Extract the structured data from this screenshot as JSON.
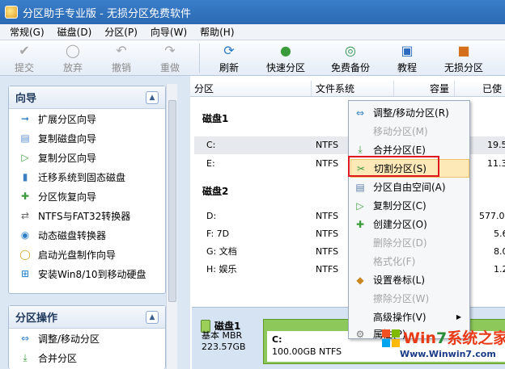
{
  "window": {
    "title": "分区助手专业版 - 无损分区免费软件"
  },
  "menubar": [
    "常规(G)",
    "磁盘(D)",
    "分区(P)",
    "向导(W)",
    "帮助(H)"
  ],
  "toolbar": {
    "submit": "提交",
    "discard": "放弃",
    "undo": "撤销",
    "redo": "重做",
    "refresh": "刷新",
    "quick_partition": "快速分区",
    "free_backup": "免费备份",
    "tutorial": "教程",
    "lossless": "无损分区"
  },
  "wizard_panel": {
    "title": "向导",
    "items": [
      "扩展分区向导",
      "复制磁盘向导",
      "复制分区向导",
      "迁移系统到固态磁盘",
      "分区恢复向导",
      "NTFS与FAT32转换器",
      "动态磁盘转换器",
      "启动光盘制作向导",
      "安装Win8/10到移动硬盘"
    ]
  },
  "ops_panel": {
    "title": "分区操作",
    "items": [
      "调整/移动分区",
      "合并分区"
    ]
  },
  "table": {
    "columns": [
      "分区",
      "文件系统",
      "容量",
      "已使"
    ],
    "disk1": "磁盘1",
    "disk2": "磁盘2",
    "disk1_rows": [
      {
        "name": "C:",
        "fs": "NTFS",
        "used": "19.5"
      },
      {
        "name": "E:",
        "fs": "NTFS",
        "used": "11.3"
      }
    ],
    "disk2_rows": [
      {
        "name": "D:",
        "fs": "NTFS",
        "used": "577.0"
      },
      {
        "name": "F: 7D",
        "fs": "NTFS",
        "used": "5.6"
      },
      {
        "name": "G: 文档",
        "fs": "NTFS",
        "used": "8.0"
      },
      {
        "name": "H: 娱乐",
        "fs": "NTFS",
        "used": "1.2"
      }
    ]
  },
  "diskmap": {
    "name": "磁盘1",
    "type": "基本 MBR",
    "size": "223.57GB",
    "partition_label": "C:",
    "partition_info": "100.00GB NTFS"
  },
  "context_menu": [
    {
      "label": "调整/移动分区(R)",
      "enabled": true
    },
    {
      "label": "移动分区(M)",
      "enabled": false
    },
    {
      "label": "合并分区(E)",
      "enabled": true
    },
    {
      "label": "切割分区(S)",
      "enabled": true,
      "highlighted": true
    },
    {
      "label": "分区自由空间(A)",
      "enabled": true
    },
    {
      "label": "复制分区(C)",
      "enabled": true
    },
    {
      "label": "创建分区(O)",
      "enabled": true
    },
    {
      "label": "删除分区(D)",
      "enabled": false
    },
    {
      "label": "格式化(F)",
      "enabled": false
    },
    {
      "label": "设置卷标(L)",
      "enabled": true
    },
    {
      "label": "擦除分区(W)",
      "enabled": false
    },
    {
      "label": "高级操作(V)",
      "enabled": true,
      "submenu": true
    },
    {
      "label": "属性(P)",
      "enabled": true
    }
  ],
  "watermark": {
    "brand_a": "Win",
    "brand_b": "7",
    "brand_c": "系统之家",
    "url": "Www.Winwin7.com"
  },
  "colors": {
    "titlebar": "#2b69b3",
    "highlight": "#fde9b8",
    "redbox": "#e0181d",
    "partition_green": "#8cc85a"
  }
}
